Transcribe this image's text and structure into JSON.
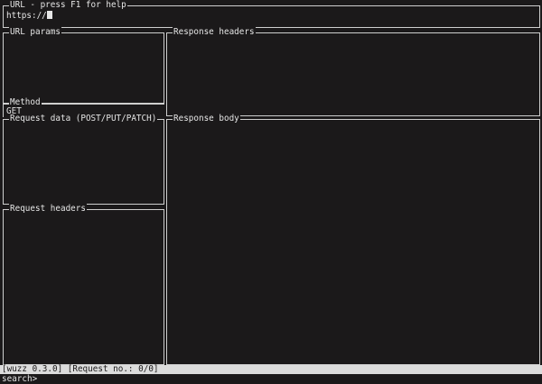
{
  "url_box": {
    "title": "URL - press F1 for help",
    "value": "https://"
  },
  "url_params": {
    "title": "URL params"
  },
  "method": {
    "title": "Method",
    "value": "GET"
  },
  "request_data": {
    "title": "Request data (POST/PUT/PATCH)"
  },
  "request_headers": {
    "title": "Request headers"
  },
  "response_headers": {
    "title": "Response headers"
  },
  "response_body": {
    "title": "Response body"
  },
  "status_bar": {
    "text": "[wuzz 0.3.0] [Request no.: 0/0]"
  },
  "search": {
    "prompt": "search>"
  }
}
